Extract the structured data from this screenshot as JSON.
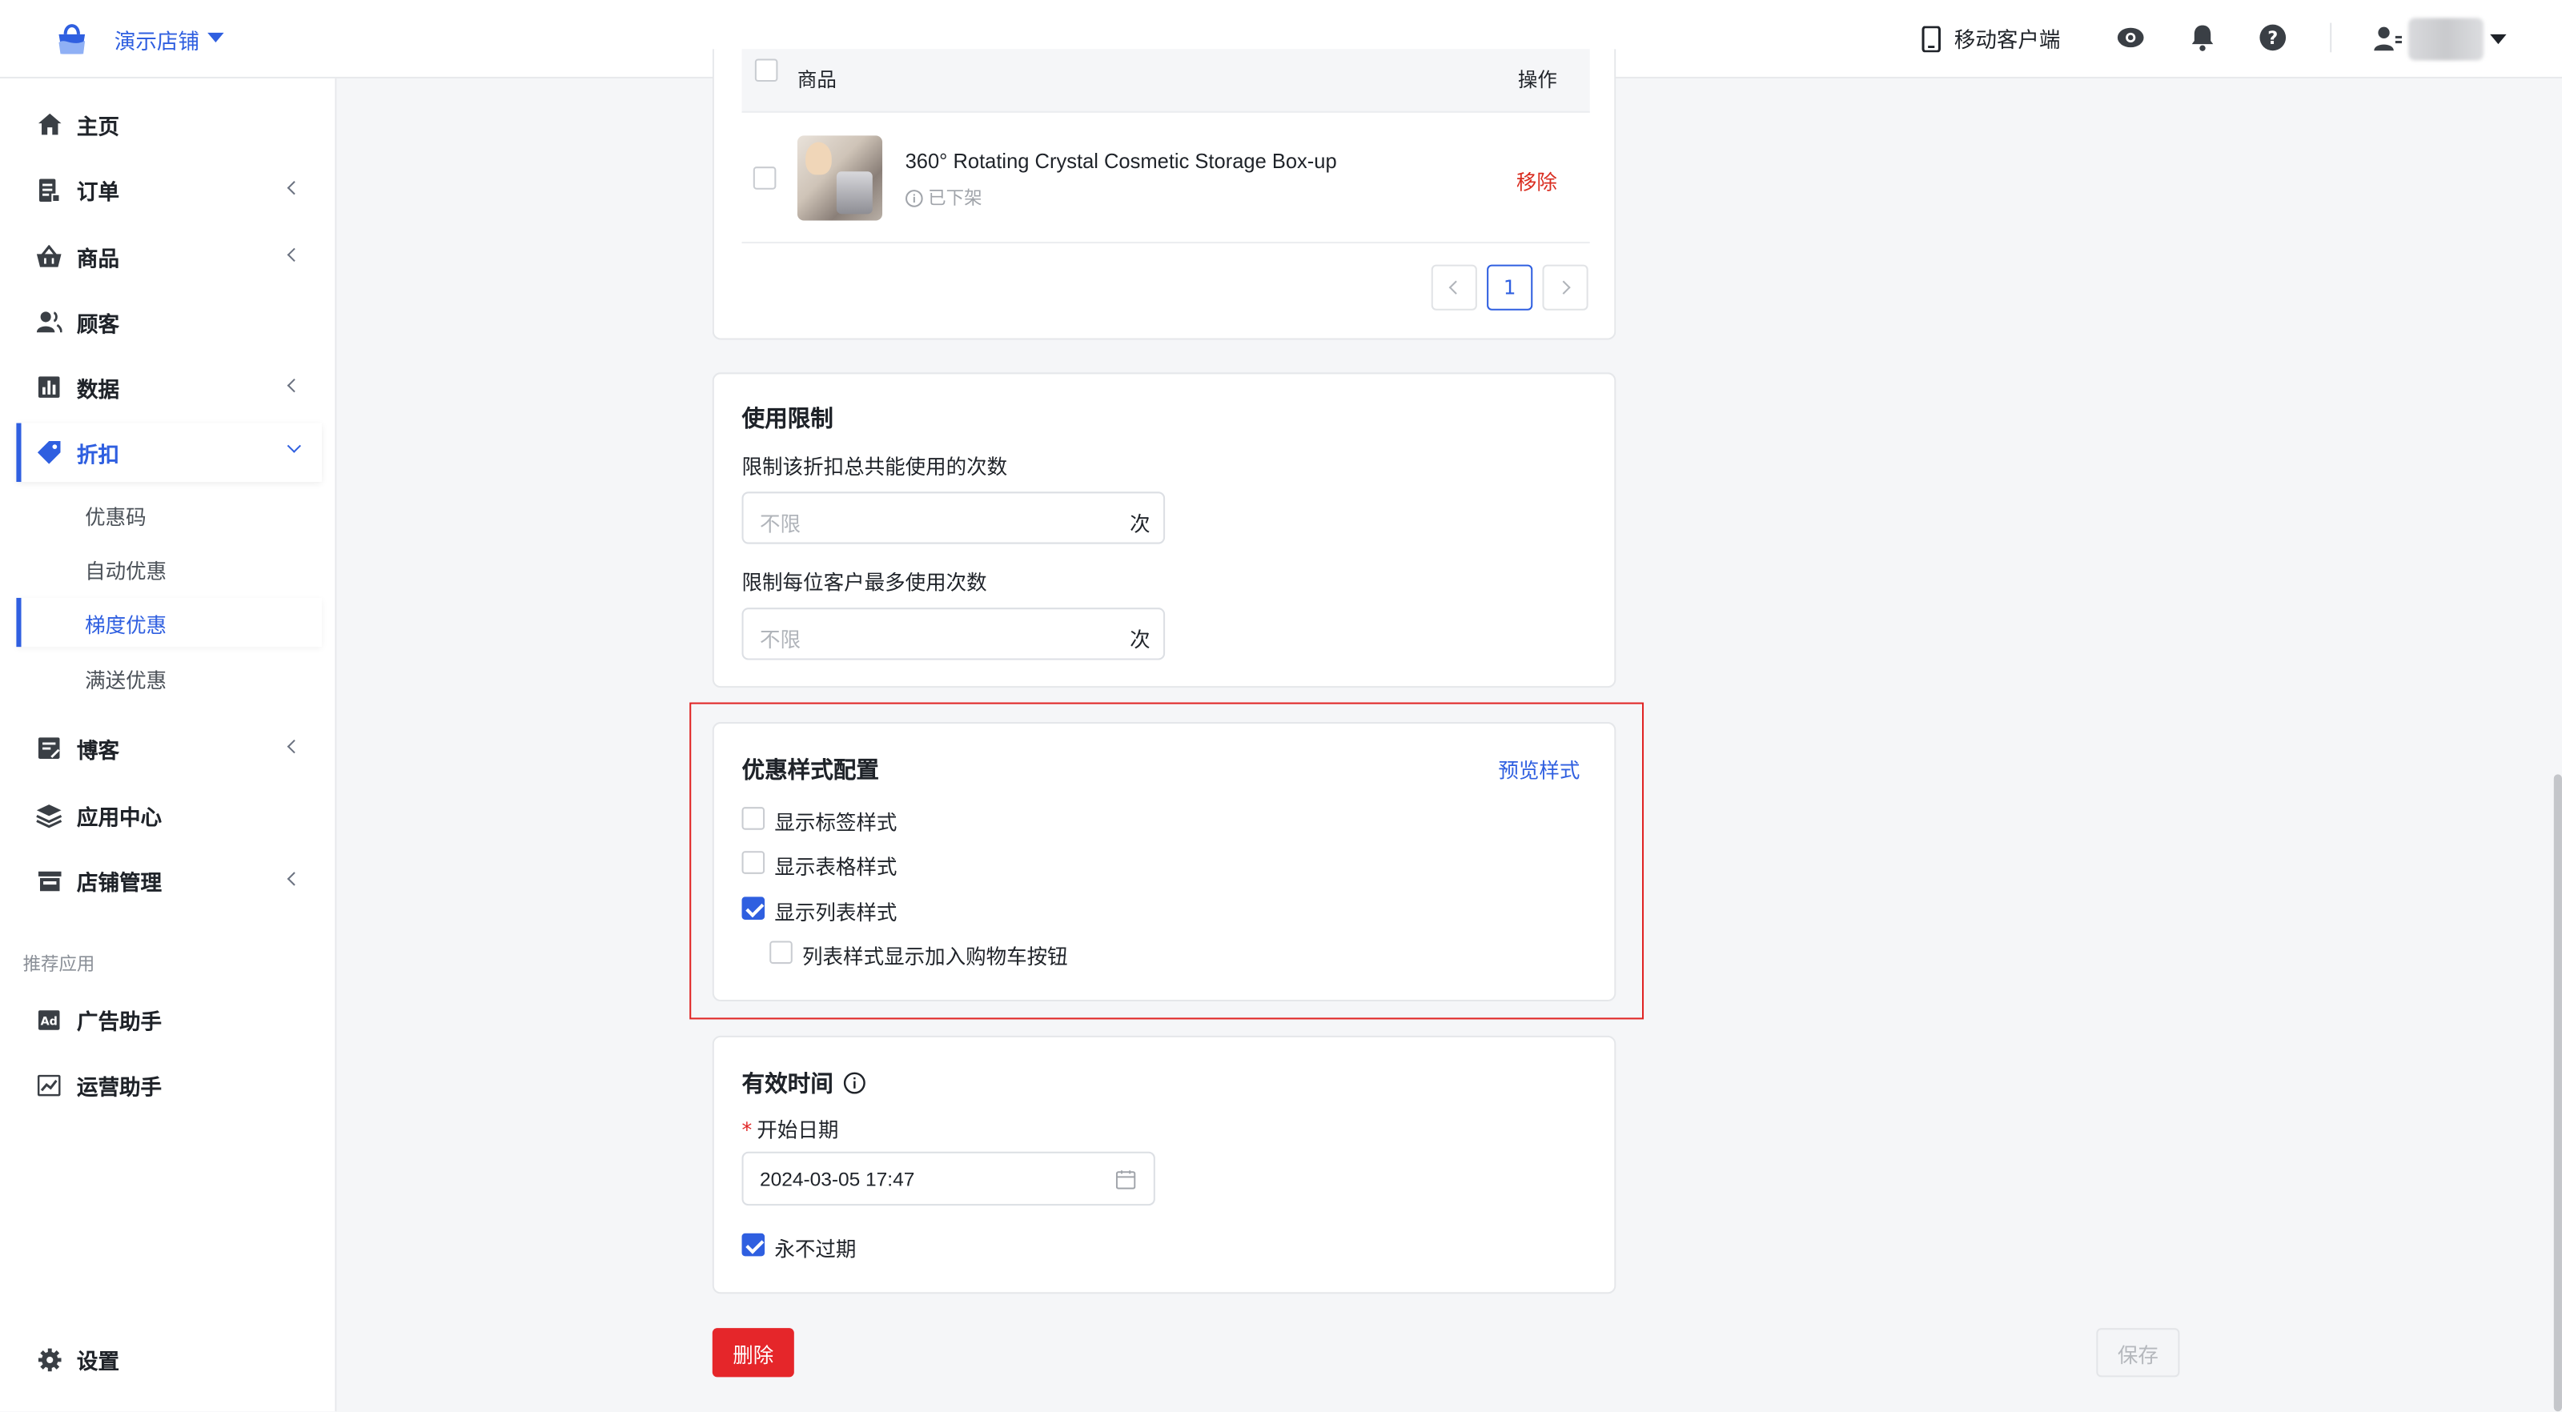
{
  "topbar": {
    "store_name": "演示店铺",
    "mobile_client": "移动客户端"
  },
  "sidebar": {
    "items": [
      {
        "label": "主页",
        "icon": "home-icon"
      },
      {
        "label": "订单",
        "icon": "order-icon"
      },
      {
        "label": "商品",
        "icon": "basket-icon"
      },
      {
        "label": "顾客",
        "icon": "users-icon"
      },
      {
        "label": "数据",
        "icon": "chart-icon"
      },
      {
        "label": "折扣",
        "icon": "tag-icon"
      },
      {
        "label": "博客",
        "icon": "blog-icon"
      },
      {
        "label": "应用中心",
        "icon": "layers-icon"
      },
      {
        "label": "店铺管理",
        "icon": "store-icon"
      }
    ],
    "discount_sub": [
      "优惠码",
      "自动优惠",
      "梯度优惠",
      "满送优惠"
    ],
    "recommended_label": "推荐应用",
    "recommended": [
      {
        "label": "广告助手",
        "icon": "ad-icon"
      },
      {
        "label": "运营助手",
        "icon": "trend-icon"
      }
    ],
    "settings": "设置"
  },
  "product_card": {
    "header_col1": "商品",
    "header_col2": "操作",
    "product_name": "360° Rotating Crystal Cosmetic Storage Box-up",
    "product_status": "已下架",
    "remove": "移除",
    "current_page": "1"
  },
  "usage_limit": {
    "title": "使用限制",
    "total_label": "限制该折扣总共能使用的次数",
    "total_placeholder": "不限",
    "per_customer_label": "限制每位客户最多使用次数",
    "per_customer_placeholder": "不限",
    "unit": "次"
  },
  "style_config": {
    "title": "优惠样式配置",
    "preview": "预览样式",
    "options": [
      {
        "label": "显示标签样式",
        "checked": false
      },
      {
        "label": "显示表格样式",
        "checked": false
      },
      {
        "label": "显示列表样式",
        "checked": true
      },
      {
        "label": "列表样式显示加入购物车按钮",
        "checked": false
      }
    ]
  },
  "valid_time": {
    "title": "有效时间",
    "start_label": "开始日期",
    "start_value": "2024-03-05 17:47",
    "never_expire": "永不过期",
    "never_expire_checked": true
  },
  "actions": {
    "delete": "删除",
    "save": "保存"
  },
  "colors": {
    "accent": "#2f5fe0",
    "danger": "#e5262a",
    "highlight_border": "#e02424"
  }
}
